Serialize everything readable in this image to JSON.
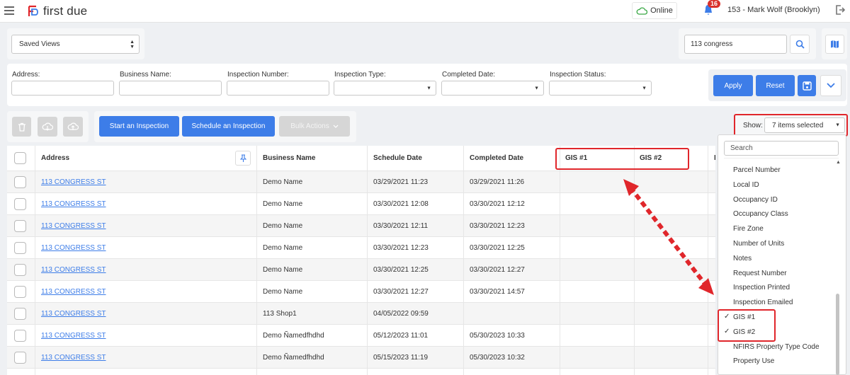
{
  "app": {
    "name": "first due"
  },
  "header": {
    "status": "Online",
    "notification_count": "16",
    "user": "153 - Mark Wolf (Brooklyn)"
  },
  "toolbar": {
    "saved_views": "Saved Views",
    "search_value": "113 congress"
  },
  "filters": {
    "address_label": "Address:",
    "business_label": "Business Name:",
    "inspection_number_label": "Inspection Number:",
    "inspection_type_label": "Inspection Type:",
    "completed_date_label": "Completed Date:",
    "inspection_status_label": "Inspection Status:",
    "apply": "Apply",
    "reset": "Reset"
  },
  "actions": {
    "start": "Start an Inspection",
    "schedule": "Schedule an Inspection",
    "bulk": "Bulk Actions",
    "show_label": "Show:",
    "show_value": "7 items selected"
  },
  "table": {
    "headers": {
      "address": "Address",
      "business": "Business Name",
      "schedule": "Schedule Date",
      "completed": "Completed Date",
      "gis1": "GIS #1",
      "gis2": "GIS #2",
      "extra": "P"
    },
    "rows": [
      {
        "address": "113 CONGRESS ST",
        "business": "Demo Name",
        "schedule": "03/29/2021 11:23",
        "completed": "03/29/2021 11:26"
      },
      {
        "address": "113 CONGRESS ST",
        "business": "Demo Name",
        "schedule": "03/30/2021 12:08",
        "completed": "03/30/2021 12:12"
      },
      {
        "address": "113 CONGRESS ST",
        "business": "Demo Name",
        "schedule": "03/30/2021 12:11",
        "completed": "03/30/2021 12:23"
      },
      {
        "address": "113 CONGRESS ST",
        "business": "Demo Name",
        "schedule": "03/30/2021 12:23",
        "completed": "03/30/2021 12:25"
      },
      {
        "address": "113 CONGRESS ST",
        "business": "Demo Name",
        "schedule": "03/30/2021 12:25",
        "completed": "03/30/2021 12:27"
      },
      {
        "address": "113 CONGRESS ST",
        "business": "Demo Name",
        "schedule": "03/30/2021 12:27",
        "completed": "03/30/2021 14:57"
      },
      {
        "address": "113 CONGRESS ST",
        "business": "113 Shop1",
        "schedule": "04/05/2022 09:59",
        "completed": ""
      },
      {
        "address": "113 CONGRESS ST",
        "business": "Demo Ñamedfhdhd",
        "schedule": "05/12/2023 11:01",
        "completed": "05/30/2023 10:33"
      },
      {
        "address": "113 CONGRESS ST",
        "business": "Demo Ñamedfhdhd",
        "schedule": "05/15/2023 11:19",
        "completed": "05/30/2023 10:32"
      }
    ]
  },
  "column_picker": {
    "search_placeholder": "Search",
    "items": [
      {
        "label": "Parcel Number",
        "checked": false
      },
      {
        "label": "Local ID",
        "checked": false
      },
      {
        "label": "Occupancy ID",
        "checked": false
      },
      {
        "label": "Occupancy Class",
        "checked": false
      },
      {
        "label": "Fire Zone",
        "checked": false
      },
      {
        "label": "Number of Units",
        "checked": false
      },
      {
        "label": "Notes",
        "checked": false
      },
      {
        "label": "Request Number",
        "checked": false
      },
      {
        "label": "Inspection Printed",
        "checked": false
      },
      {
        "label": "Inspection Emailed",
        "checked": false
      },
      {
        "label": "GIS #1",
        "checked": true
      },
      {
        "label": "GIS #2",
        "checked": true
      },
      {
        "label": "NFIRS Property Type Code",
        "checked": false
      },
      {
        "label": "Property Use",
        "checked": false
      }
    ]
  },
  "colors": {
    "accent": "#3d7de8",
    "annotation": "#e0262b",
    "badge": "#d9312b"
  }
}
